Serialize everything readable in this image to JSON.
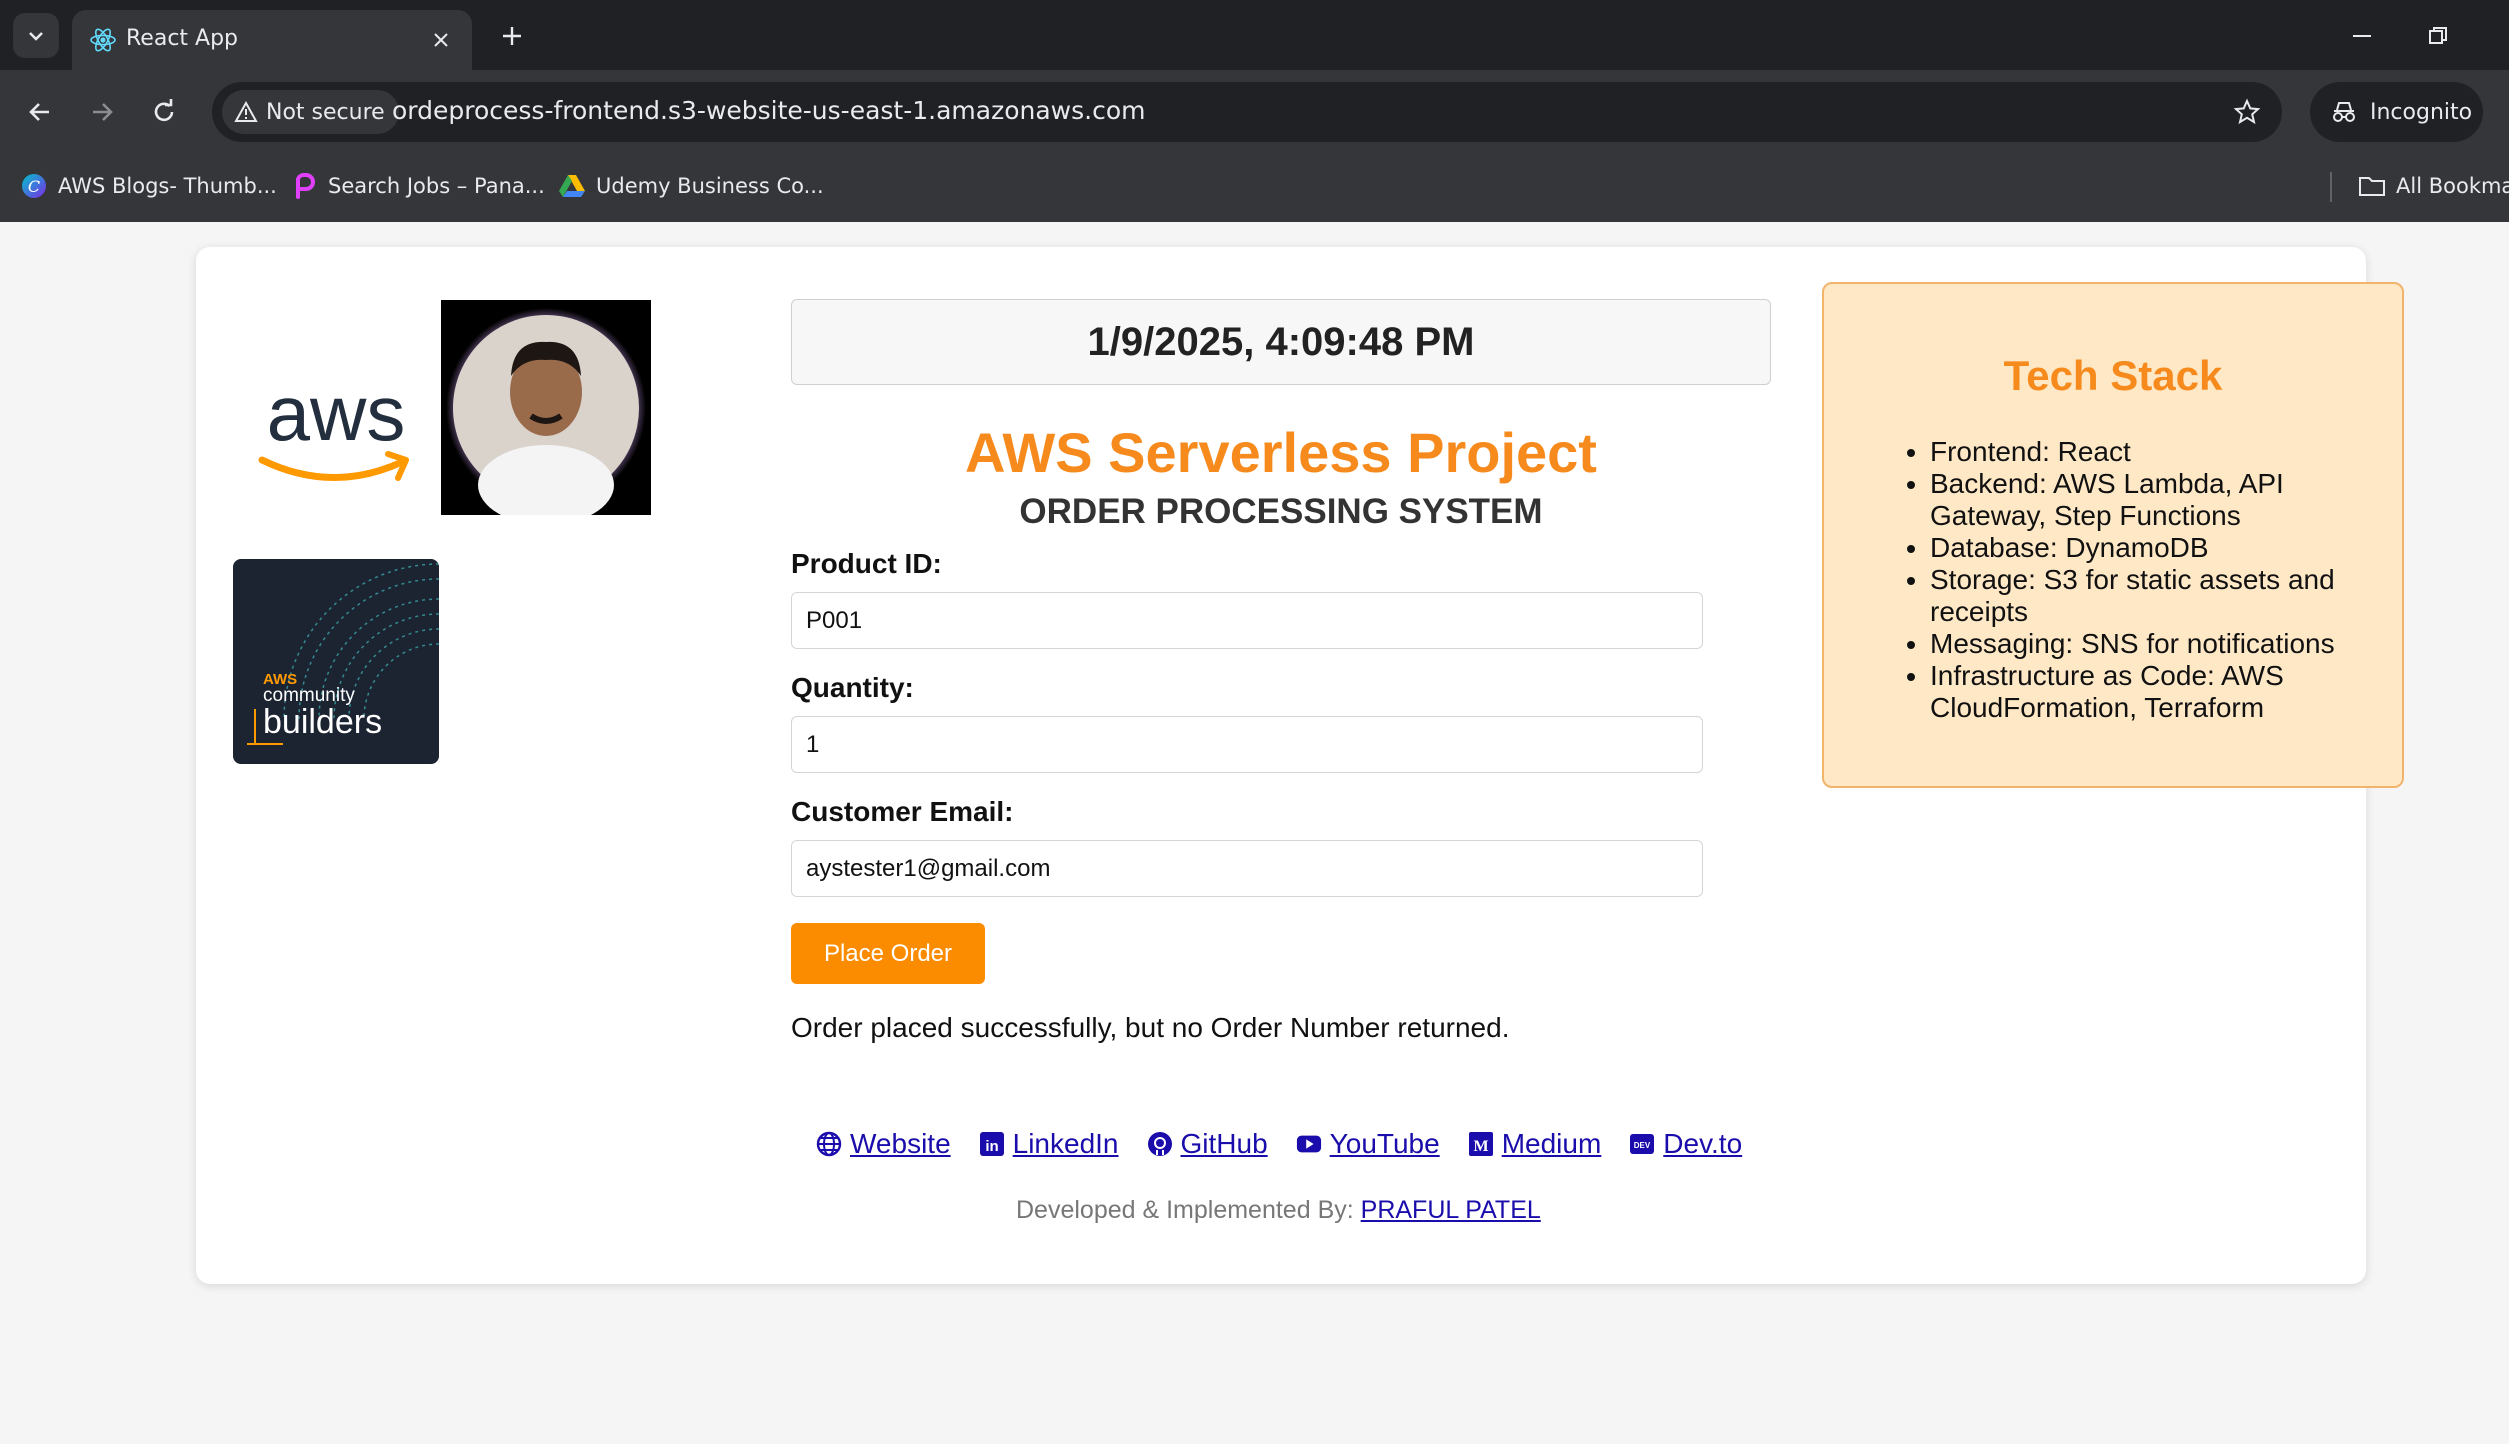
{
  "browser": {
    "tab_title": "React App",
    "security_label": "Not secure",
    "url": "ordeprocess-frontend.s3-website-us-east-1.amazonaws.com",
    "incognito_label": "Incognito",
    "bookmarks": [
      {
        "label": "AWS Blogs- Thumb...",
        "icon": "c-circle-icon"
      },
      {
        "label": "Search Jobs – Pana...",
        "icon": "p-logo-icon"
      },
      {
        "label": "Udemy Business Co...",
        "icon": "google-drive-icon"
      }
    ],
    "all_bookmarks_label": "All Bookma"
  },
  "page": {
    "clock": "1/9/2025, 4:09:48 PM",
    "title": "AWS Serverless Project",
    "subtitle": "ORDER PROCESSING SYSTEM",
    "form": {
      "product_label": "Product ID:",
      "product_value": "P001",
      "quantity_label": "Quantity:",
      "quantity_value": "1",
      "email_label": "Customer Email:",
      "email_value": "aystester1@gmail.com",
      "submit_label": "Place Order"
    },
    "status_message": "Order placed successfully, but no Order Number returned.",
    "links": [
      {
        "label": "Website",
        "icon": "globe-icon"
      },
      {
        "label": "LinkedIn",
        "icon": "linkedin-icon"
      },
      {
        "label": "GitHub",
        "icon": "github-icon"
      },
      {
        "label": "YouTube",
        "icon": "youtube-icon"
      },
      {
        "label": "Medium",
        "icon": "medium-icon"
      },
      {
        "label": "Dev.to",
        "icon": "devto-icon"
      }
    ],
    "credit_prefix": "Developed & Implemented By:",
    "credit_name": "PRAFUL PATEL",
    "logos": {
      "aws_wordmark": "aws",
      "builders_line1": "AWS",
      "builders_line2": "community",
      "builders_line3": "builders"
    }
  },
  "tech_stack": {
    "title": "Tech Stack",
    "items": [
      "Frontend: React",
      "Backend: AWS Lambda, API Gateway, Step Functions",
      "Database: DynamoDB",
      "Storage: S3 for static assets and receipts",
      "Messaging: SNS for notifications",
      "Infrastructure as Code: AWS CloudFormation, Terraform"
    ]
  },
  "colors": {
    "accent_orange": "#f68a1c",
    "button_orange": "#fb8c00",
    "tech_box_bg": "#ffe8c6",
    "link_blue": "#1a0dab"
  }
}
